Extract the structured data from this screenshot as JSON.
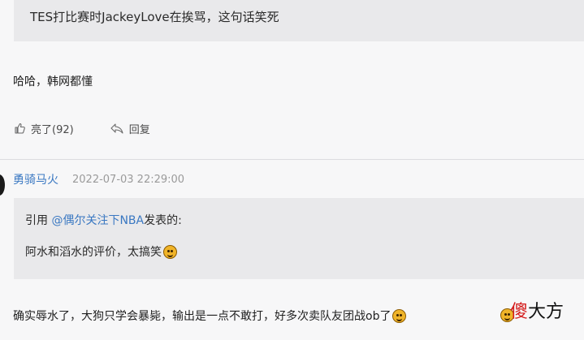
{
  "prev_comment": {
    "quote_text": "TES打比赛时JackeyLove在挨骂，这句话笑死",
    "body": "哈哈，韩网都懂",
    "like_label": "亮了(92)",
    "reply_label": "回复"
  },
  "comment": {
    "author": "勇骑马火",
    "time": "2022-07-03 22:29:00",
    "quote_prefix": "引用 ",
    "quote_mention": "@偶尔关注下NBA",
    "quote_suffix": "发表的:",
    "quote_content": "阿水和滔水的评价，太搞笑",
    "body": "确实辱水了，大狗只学会暴毙，输出是一点不敢打，好多次卖队友团战ob了"
  },
  "icons": {
    "like": "thumbs-up-icon",
    "reply": "reply-arrow-icon",
    "emoji": "laughing-face-emoji"
  },
  "watermark": {
    "first_char": "傻",
    "rest": "大方"
  },
  "colors": {
    "link": "#3a78c2",
    "quote_bg": "#e9e9eb",
    "page_bg": "#f7f7f8",
    "watermark_red": "#d41c1c"
  }
}
